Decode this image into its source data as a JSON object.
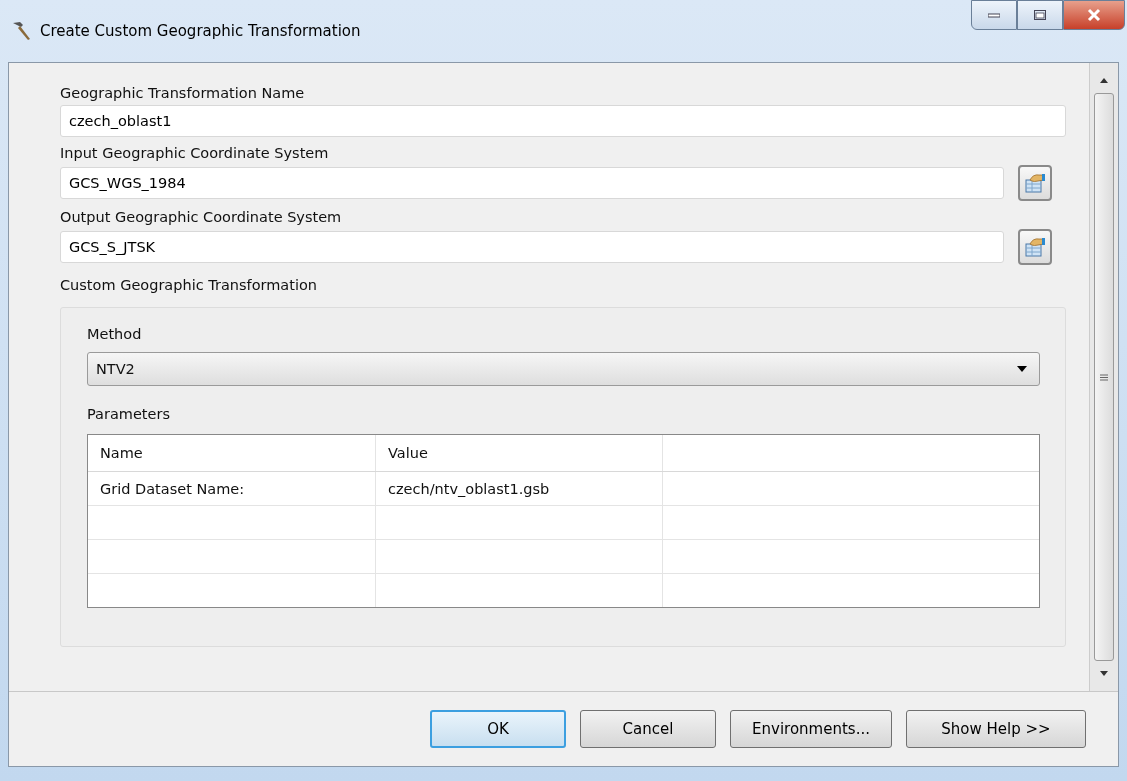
{
  "window": {
    "title": "Create Custom Geographic Transformation"
  },
  "fields": [
    {
      "label": "Geographic Transformation Name",
      "value": "czech_oblast1",
      "browse": false
    },
    {
      "label": "Input Geographic Coordinate System",
      "value": "GCS_WGS_1984",
      "browse": true
    },
    {
      "label": "Output Geographic Coordinate System",
      "value": "GCS_S_JTSK",
      "browse": true
    }
  ],
  "custom": {
    "label": "Custom Geographic Transformation",
    "method_label": "Method",
    "method": "NTV2",
    "parameters_label": "Parameters",
    "table": {
      "columns": [
        "Name",
        "Value"
      ],
      "rows": [
        [
          "Grid Dataset Name:",
          "czech/ntv_oblast1.gsb"
        ],
        [
          "",
          ""
        ],
        [
          "",
          ""
        ],
        [
          "",
          ""
        ]
      ]
    }
  },
  "buttons": [
    {
      "label": "OK",
      "default": true
    },
    {
      "label": "Cancel",
      "default": false
    },
    {
      "label": "Environments...",
      "default": false
    },
    {
      "label": "Show Help >>",
      "default": false
    }
  ]
}
